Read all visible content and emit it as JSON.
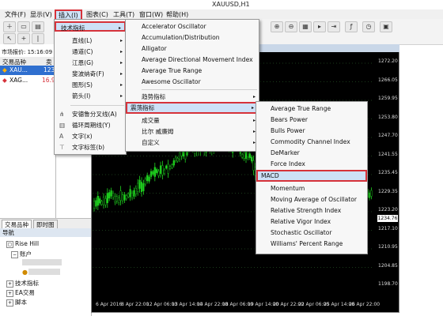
{
  "window": {
    "title": "XAUUSD,H1"
  },
  "menubar": [
    {
      "label": "文件(F)"
    },
    {
      "label": "显示(V)"
    },
    {
      "label": "插入(I)"
    },
    {
      "label": "图表(C)"
    },
    {
      "label": "工具(T)"
    },
    {
      "label": "窗口(W)"
    },
    {
      "label": "帮助(H)"
    }
  ],
  "market_watch": {
    "header": "市场报价: 15:16:09",
    "columns": [
      "交易品种",
      "卖"
    ],
    "rows": [
      {
        "symbol": "XAU...",
        "bid": "123"
      },
      {
        "symbol": "XAG...",
        "bid": "16.9"
      }
    ],
    "tabs": [
      "交易品种",
      "即时图"
    ]
  },
  "navigator": {
    "title": "导航",
    "items": [
      "Rise Hill",
      "账户",
      "技术指标",
      "EA交易",
      "脚本"
    ]
  },
  "insert_menu": {
    "items": [
      {
        "label": "技术指标",
        "arrow": "▸"
      },
      {
        "label": "直线(L)",
        "arrow": "▸"
      },
      {
        "label": "通道(C)",
        "arrow": "▸"
      },
      {
        "label": "江恩(G)",
        "arrow": "▸"
      },
      {
        "label": "斐波纳奇(F)",
        "arrow": "▸"
      },
      {
        "label": "图形(S)",
        "arrow": "▸"
      },
      {
        "label": "箭头(I)",
        "arrow": "▸"
      },
      {
        "label": "安德鲁分叉线(A)"
      },
      {
        "label": "循环周期线(Y)"
      },
      {
        "label": "文字(x)"
      },
      {
        "label": "文字标签(b)"
      }
    ]
  },
  "indicators_menu": {
    "items": [
      {
        "label": "Accelerator Oscillator"
      },
      {
        "label": "Accumulation/Distribution"
      },
      {
        "label": "Alligator"
      },
      {
        "label": "Average Directional Movement Index"
      },
      {
        "label": "Average True Range"
      },
      {
        "label": "Awesome Oscillator"
      },
      {
        "label": "趋势指标",
        "arrow": "▸"
      },
      {
        "label": "震荡指标",
        "arrow": "▸"
      },
      {
        "label": "成交量",
        "arrow": "▸"
      },
      {
        "label": "比尔 威廉姆",
        "arrow": "▸"
      },
      {
        "label": "自定义",
        "arrow": "▸"
      }
    ]
  },
  "oscillators_menu": {
    "items": [
      {
        "label": "Average True Range"
      },
      {
        "label": "Bears Power"
      },
      {
        "label": "Bulls Power"
      },
      {
        "label": "Commodity Channel Index"
      },
      {
        "label": "DeMarker"
      },
      {
        "label": "Force Index"
      },
      {
        "label": "MACD"
      },
      {
        "label": "Momentum"
      },
      {
        "label": "Moving Average of Oscillator"
      },
      {
        "label": "Relative Strength Index"
      },
      {
        "label": "Relative Vigor Index"
      },
      {
        "label": "Stochastic Oscillator"
      },
      {
        "label": "Williams' Percent Range"
      }
    ]
  },
  "chart": {
    "price_labels": [
      "1272.20",
      "1266.05",
      "1259.95",
      "1253.80",
      "1247.70",
      "1241.55",
      "1235.45",
      "1229.35",
      "1223.20",
      "1217.10",
      "1210.95",
      "1204.85",
      "1198.70"
    ],
    "current_price": "1234.76",
    "date_labels": [
      "6 Apr 2016",
      "8 Apr 22:00",
      "12 Apr 06:00",
      "13 Apr 14:00",
      "14 Apr 22:00",
      "18 Apr 06:00",
      "19 Apr 14:00",
      "20 Apr 22:00",
      "22 Apr 06:00",
      "25 Apr 14:00",
      "26 Apr 22:00"
    ]
  },
  "colors": {
    "highlight_red": "#d6323a",
    "selection_blue": "#cde1f7",
    "candle_green": "#1fd21f"
  }
}
